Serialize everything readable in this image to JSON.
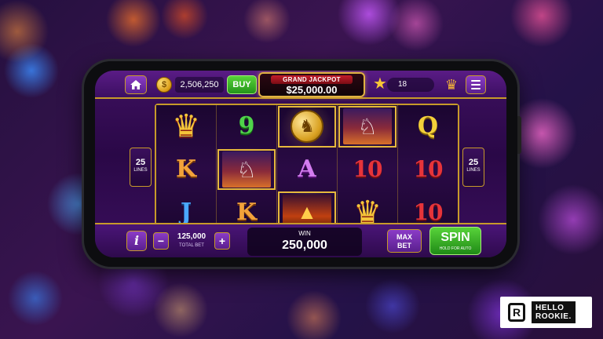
{
  "topbar": {
    "home_icon": "home-icon",
    "coin_glyph": "$",
    "balance": "2,506,250",
    "buy_label": "BUY",
    "jackpot_label": "GRAND JACKPOT",
    "jackpot_value": "$25,000.00",
    "level": "18",
    "menu_icon": "hamburger-icon"
  },
  "reels": [
    [
      "crown",
      "K",
      "J"
    ],
    [
      "9",
      "horse",
      "K"
    ],
    [
      "coin",
      "A",
      "volcano"
    ],
    [
      "horse",
      "10",
      "crown"
    ],
    [
      "Q",
      "10",
      "10"
    ]
  ],
  "lines": {
    "count": "25",
    "label": "LINES"
  },
  "bottombar": {
    "info_label": "i",
    "minus_label": "−",
    "plus_label": "+",
    "total_bet": "125,000",
    "total_bet_label": "TOTAL BET",
    "win_label": "WIN",
    "win_value": "250,000",
    "max_bet_line1": "MAX",
    "max_bet_line2": "BET",
    "spin_label": "SPIN",
    "spin_sub": "HOLD FOR AUTO"
  },
  "logo": {
    "mark": "R",
    "text_line1": "HELLO",
    "text_line2": "ROOKIE."
  },
  "colors": {
    "gold": "#c79a2a",
    "purple": "#3e1060",
    "green": "#58d33a",
    "red": "#c41c2a"
  }
}
